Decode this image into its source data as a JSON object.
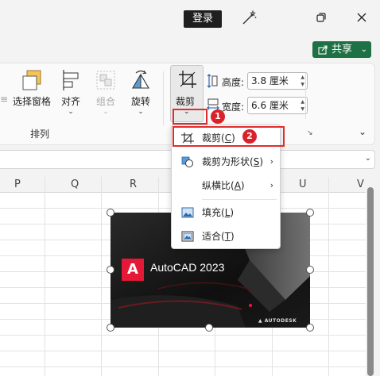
{
  "titlebar": {
    "login_label": "登录"
  },
  "share": {
    "label": "共享",
    "color": "#1e7145"
  },
  "ribbon": {
    "arrange_group": {
      "label": "排列",
      "items": [
        {
          "label": "选择窗格",
          "icon": "selection-pane-icon"
        },
        {
          "label": "对齐",
          "icon": "align-icon"
        },
        {
          "label": "组合",
          "icon": "group-icon",
          "disabled": true
        },
        {
          "label": "旋转",
          "icon": "rotate-icon"
        }
      ]
    },
    "crop": {
      "label": "裁剪",
      "badge": "1"
    },
    "size": {
      "height_label": "高度:",
      "height_value": "3.8 厘米",
      "width_label": "宽度:",
      "width_value": "6.6 厘米"
    }
  },
  "sheet": {
    "columns": [
      "P",
      "Q",
      "R",
      "S",
      "T",
      "U",
      "V"
    ]
  },
  "picture": {
    "logo_letter": "A",
    "title": "AutoCAD 2023",
    "brand": "▲ AUTODESK",
    "accent_color": "#e51937"
  },
  "crop_menu": {
    "badge": "2",
    "items": [
      {
        "label": "裁剪",
        "shortcut": "C",
        "icon": "crop-icon"
      },
      {
        "label": "裁剪为形状",
        "shortcut": "S",
        "icon": "crop-to-shape-icon",
        "submenu": true
      },
      {
        "label": "纵横比",
        "shortcut": "A",
        "submenu": true
      },
      {
        "label": "填充",
        "shortcut": "L",
        "icon": "fill-icon"
      },
      {
        "label": "适合",
        "shortcut": "T",
        "icon": "fit-icon"
      }
    ]
  }
}
